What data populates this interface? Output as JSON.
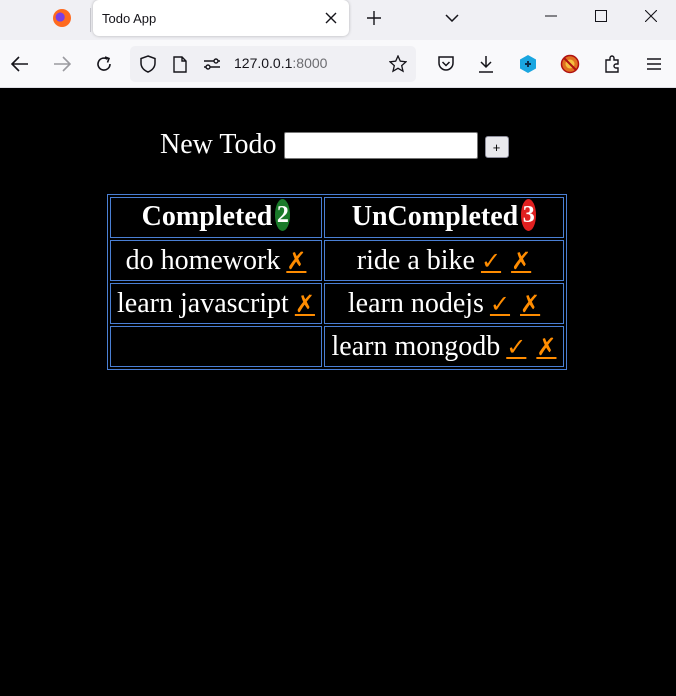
{
  "browser": {
    "tab_title": "Todo App",
    "url_host": "127.0.0.1",
    "url_port": ":8000",
    "icons": [
      "firefox-icon",
      "close-icon",
      "plus-icon",
      "chevron-down-icon",
      "minimize-icon",
      "maximize-icon",
      "window-close-icon",
      "back-icon",
      "forward-icon",
      "reload-icon",
      "shield-icon",
      "page-icon",
      "permissions-icon",
      "bookmark-star-icon",
      "pocket-icon",
      "download-icon",
      "extension-blue-icon",
      "extension-blocked-icon",
      "extensions-puzzle-icon",
      "menu-icon"
    ]
  },
  "form": {
    "label": "New Todo",
    "input_value": "",
    "add_label": "+"
  },
  "table": {
    "completed_header": "Completed",
    "completed_count": "2",
    "uncompleted_header": "UnCompleted",
    "uncompleted_count": "3",
    "done_mark": "✓",
    "delete_mark": "✗",
    "completed": [
      {
        "text": "do homework"
      },
      {
        "text": "learn javascript"
      }
    ],
    "uncompleted": [
      {
        "text": "ride a bike"
      },
      {
        "text": "learn nodejs"
      },
      {
        "text": "learn mongodb"
      }
    ]
  },
  "colors": {
    "accent_mark": "#ff8c00",
    "badge_completed": "#1a7a2a",
    "badge_uncompleted": "#e02020",
    "table_border": "#4a7fd4"
  }
}
